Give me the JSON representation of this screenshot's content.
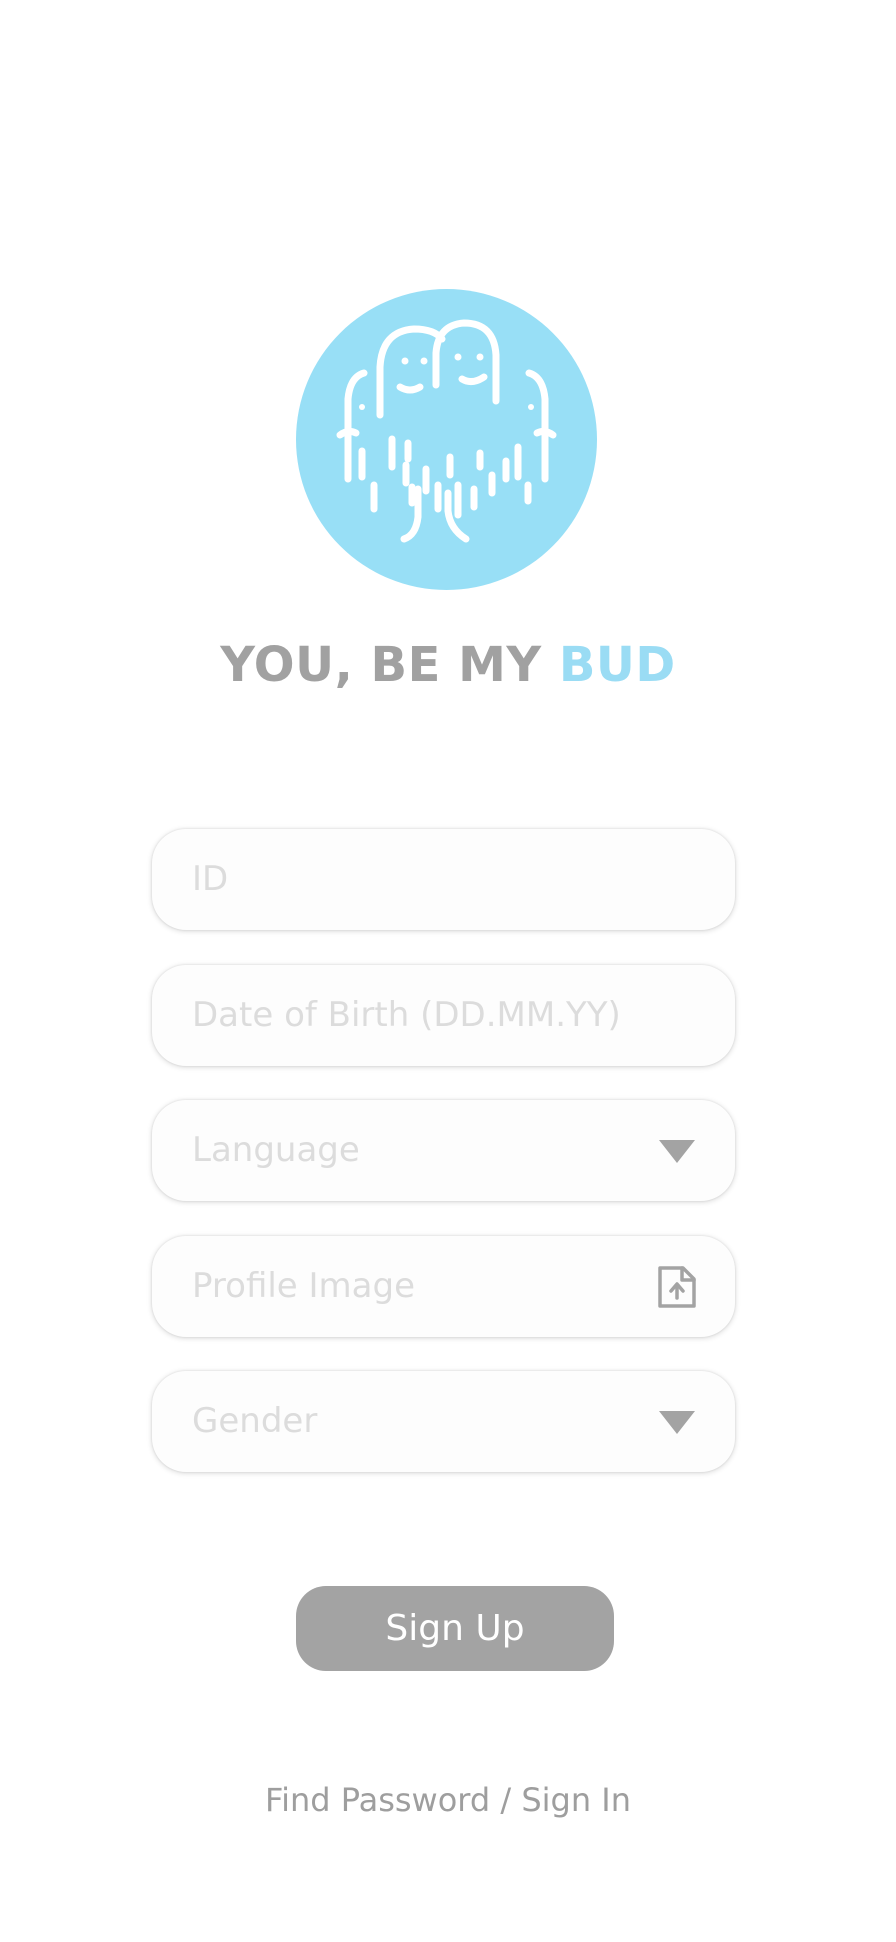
{
  "brand": {
    "part1": "YOU, BE MY ",
    "part2": "BUD"
  },
  "form": {
    "id_placeholder": "ID",
    "dob_placeholder": "Date of Birth (DD.MM.YY)",
    "language_placeholder": "Language",
    "profile_image_placeholder": "Profile Image",
    "gender_placeholder": "Gender"
  },
  "actions": {
    "sign_up_label": "Sign Up",
    "footer_link_label": "Find Password / Sign In"
  },
  "icons": {
    "logo": "buddies-logo-icon",
    "language_dropdown": "chevron-down-icon",
    "profile_upload": "file-upload-icon",
    "gender_dropdown": "chevron-down-icon"
  },
  "colors": {
    "logo_background": "#98dff6",
    "brand_gray": "#a1a1a1",
    "brand_accent": "#9adcf4",
    "button_background": "#a3a3a3"
  }
}
